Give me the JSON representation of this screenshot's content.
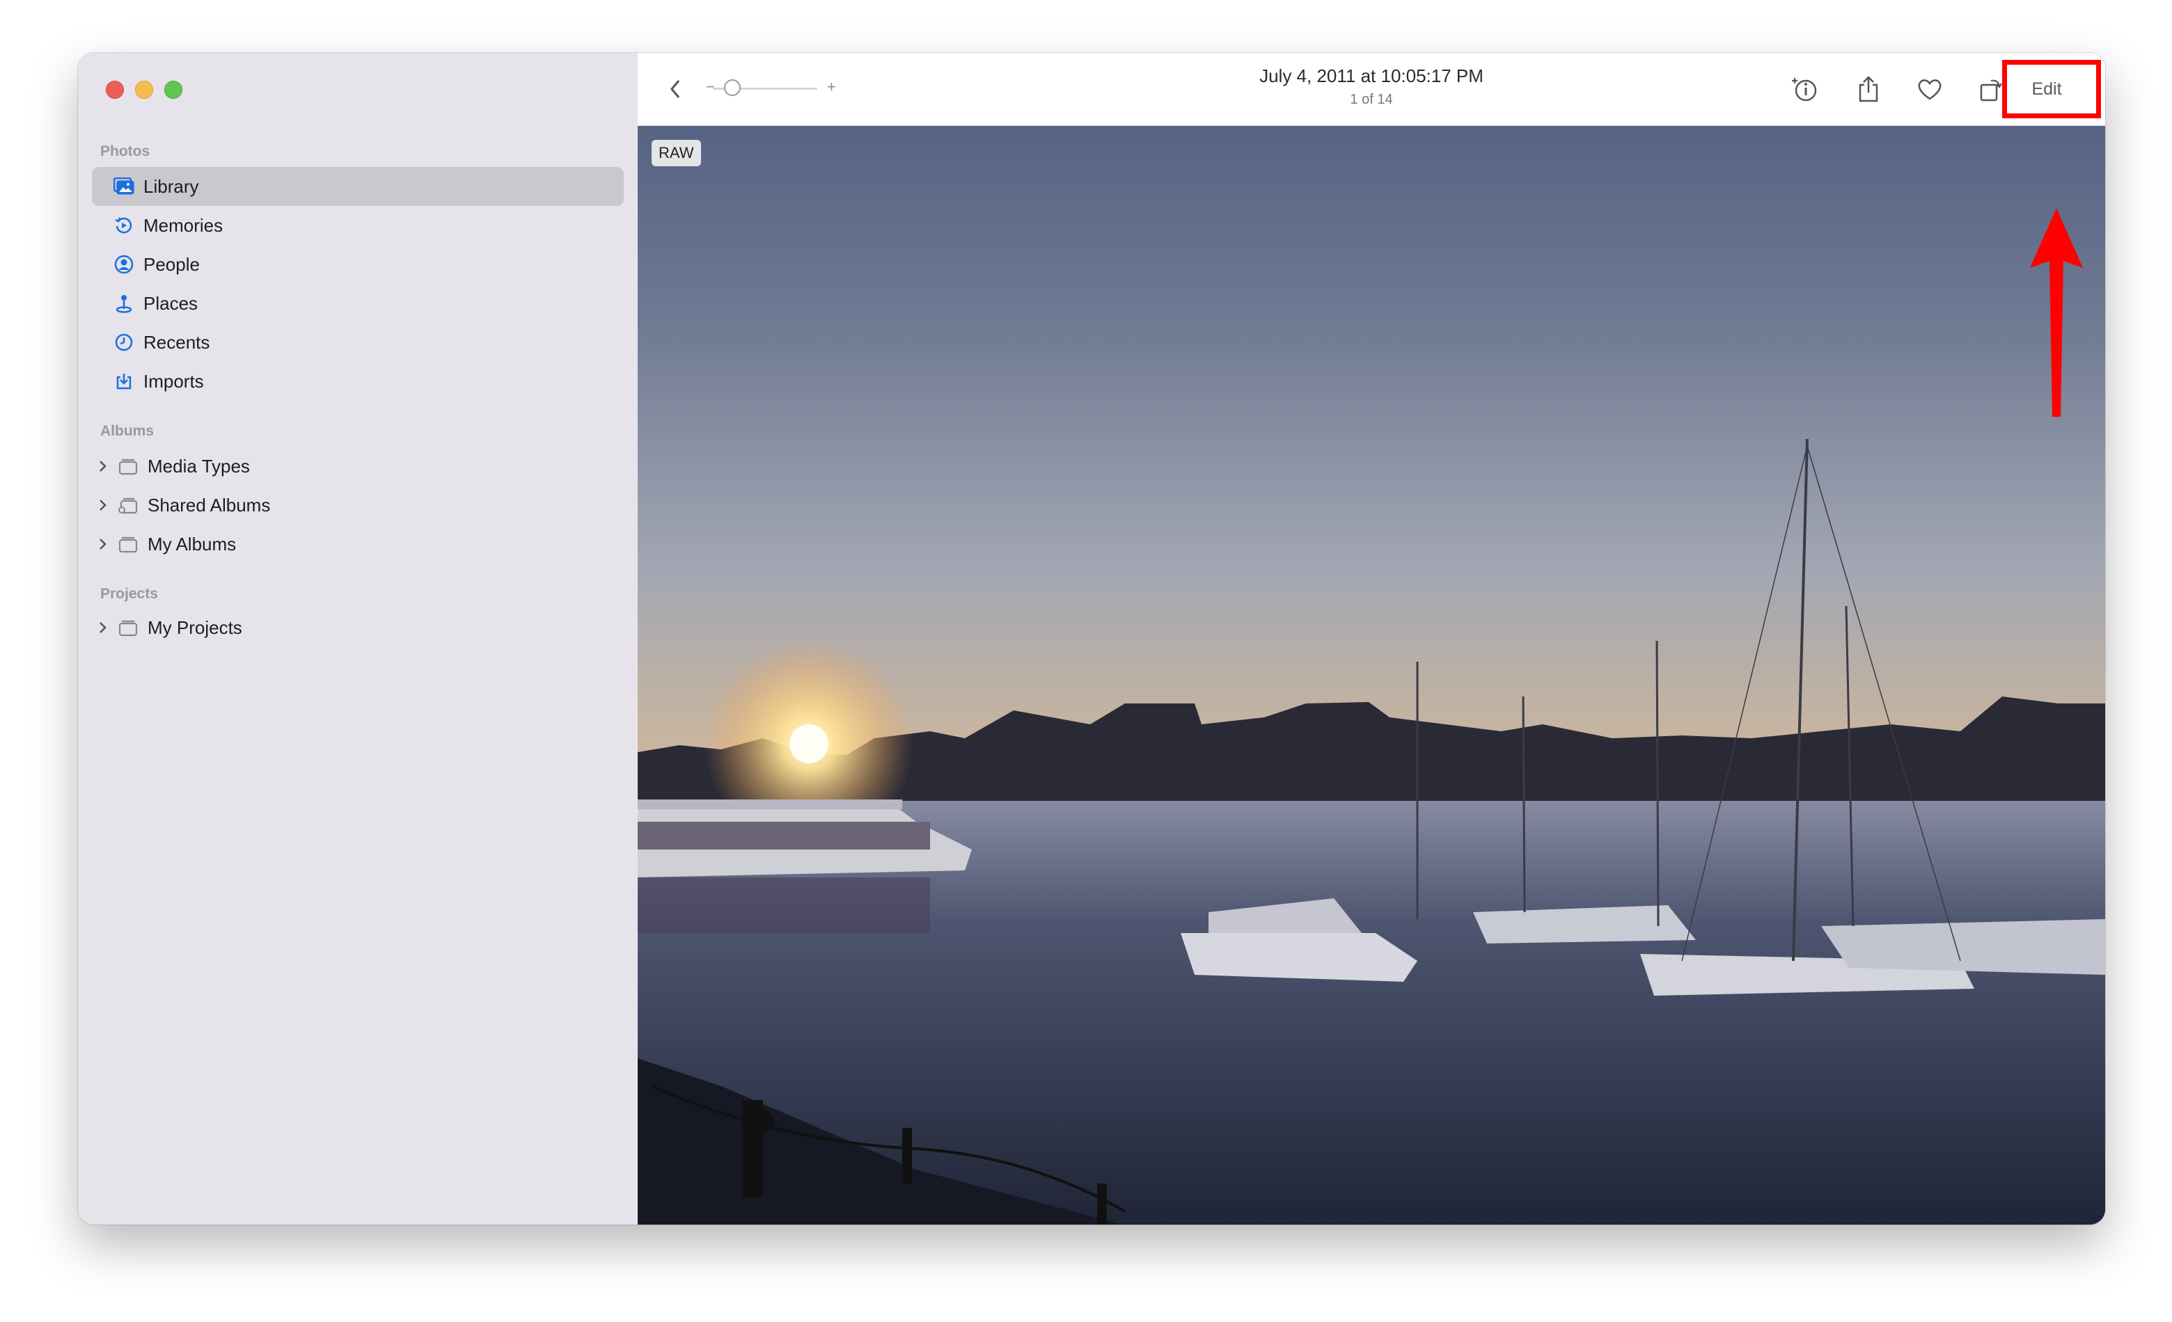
{
  "sidebar": {
    "sections": {
      "photos": "Photos",
      "albums": "Albums",
      "projects": "Projects"
    },
    "items": {
      "library": "Library",
      "memories": "Memories",
      "people": "People",
      "places": "Places",
      "recents": "Recents",
      "imports": "Imports",
      "media_types": "Media Types",
      "shared_albums": "Shared Albums",
      "my_albums": "My Albums",
      "my_projects": "My Projects"
    },
    "selected": "library"
  },
  "toolbar": {
    "date": "July 4, 2011 at 10:05:17 PM",
    "count": "1 of 14",
    "zoom_minus": "−",
    "zoom_plus": "+",
    "edit_label": "Edit"
  },
  "photo": {
    "badge": "RAW"
  },
  "colors": {
    "accent": "#1a6fe0",
    "annotation": "#ff0000",
    "selected_row": "#cbc7cf"
  },
  "icons": [
    "back-icon",
    "info-icon",
    "share-icon",
    "heart-icon",
    "rotate-icon",
    "magic-wand-icon"
  ]
}
